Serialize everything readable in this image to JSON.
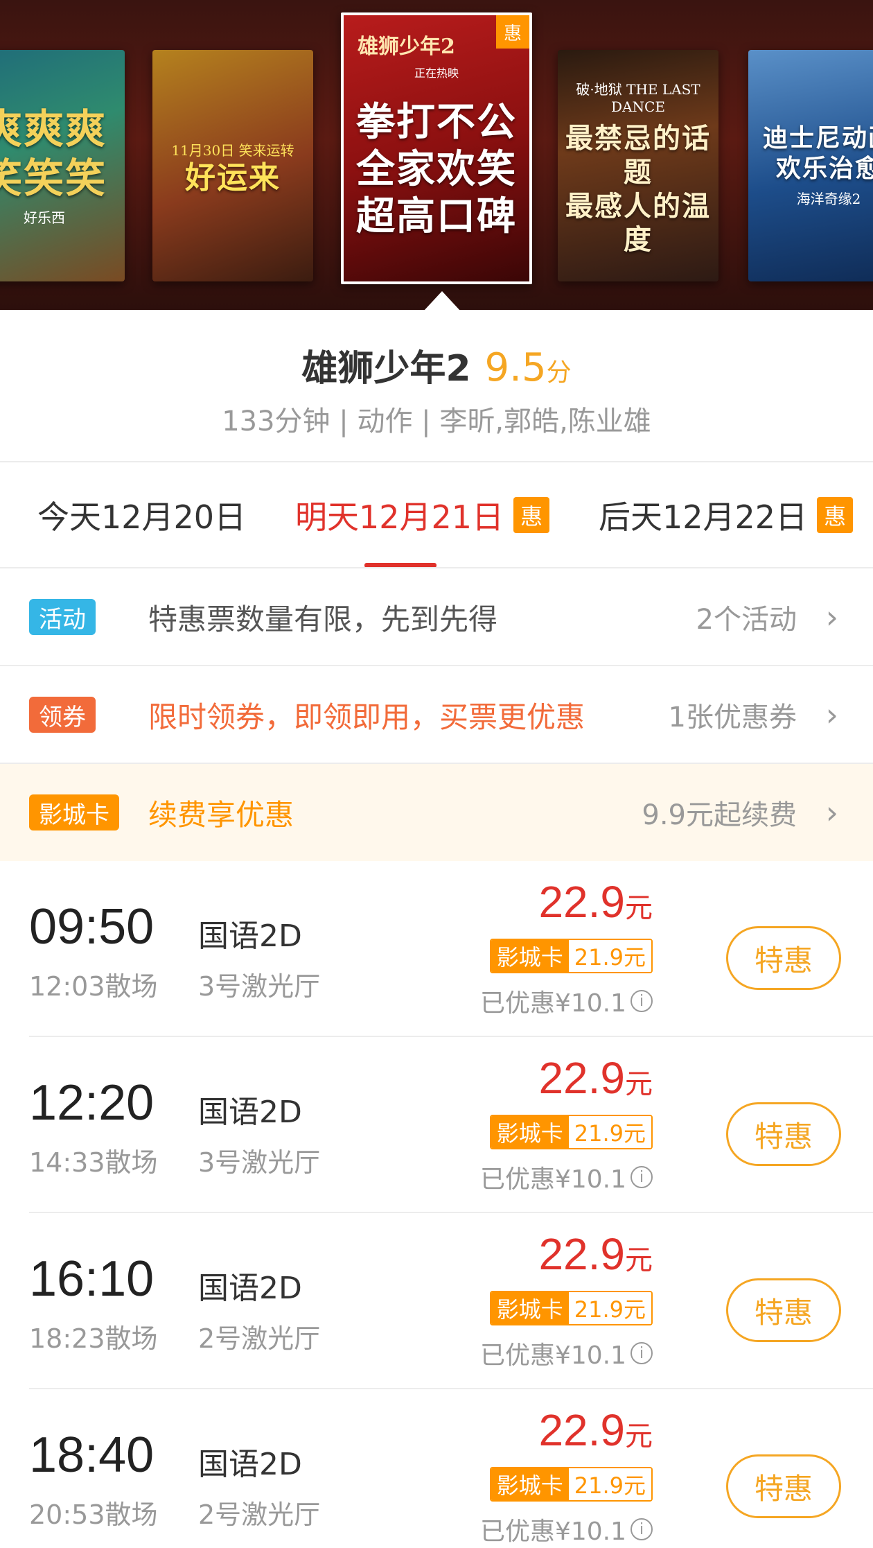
{
  "carousel": {
    "posters": [
      {
        "text": "爽爽爽\n笑笑笑",
        "sub": "好乐西"
      },
      {
        "text": "好运来",
        "sub": "11月30日 笑来运转"
      },
      {
        "title": "雄狮少年2",
        "status": "正在热映",
        "text": "拳打不公\n全家欢笑\n超高口碑",
        "badge": "惠"
      },
      {
        "text": "最禁忌的话题\n最感人的温度",
        "sub": "破·地狱 THE LAST DANCE"
      },
      {
        "text": "迪士尼动画\n欢乐治愈",
        "sub": "海洋奇缘2"
      }
    ]
  },
  "movie": {
    "title": "雄狮少年2",
    "score": "9.5",
    "score_unit": "分",
    "meta": "133分钟 | 动作 | 李昕,郭皓,陈业雄"
  },
  "dates": [
    {
      "label": "今天12月20日",
      "badge": ""
    },
    {
      "label": "明天12月21日",
      "badge": "惠"
    },
    {
      "label": "后天12月22日",
      "badge": "惠"
    }
  ],
  "promos": {
    "activity": {
      "tag": "活动",
      "text": "特惠票数量有限，先到先得",
      "right": "2个活动"
    },
    "coupon": {
      "tag": "领券",
      "text": "限时领券，即领即用，买票更优惠",
      "right": "1张优惠券"
    },
    "card": {
      "tag": "影城卡",
      "text": "续费享优惠",
      "right": "9.9元起续费"
    }
  },
  "colors": {
    "accent_red": "#e0322b",
    "accent_orange": "#ff9500",
    "activity_blue": "#35b6e6",
    "coupon_orange": "#f26b3a",
    "score": "#f5a623"
  },
  "showtimes": [
    {
      "start": "09:50",
      "end": "12:03散场",
      "lang": "国语2D",
      "hall": "3号激光厅",
      "price": "22.9",
      "unit": "元",
      "card_label": "影城卡",
      "card_price": "21.9元",
      "saved": "已优惠¥10.1",
      "button": "特惠"
    },
    {
      "start": "12:20",
      "end": "14:33散场",
      "lang": "国语2D",
      "hall": "3号激光厅",
      "price": "22.9",
      "unit": "元",
      "card_label": "影城卡",
      "card_price": "21.9元",
      "saved": "已优惠¥10.1",
      "button": "特惠"
    },
    {
      "start": "16:10",
      "end": "18:23散场",
      "lang": "国语2D",
      "hall": "2号激光厅",
      "price": "22.9",
      "unit": "元",
      "card_label": "影城卡",
      "card_price": "21.9元",
      "saved": "已优惠¥10.1",
      "button": "特惠"
    },
    {
      "start": "18:40",
      "end": "20:53散场",
      "lang": "国语2D",
      "hall": "2号激光厅",
      "price": "22.9",
      "unit": "元",
      "card_label": "影城卡",
      "card_price": "21.9元",
      "saved": "已优惠¥10.1",
      "button": "特惠"
    }
  ]
}
